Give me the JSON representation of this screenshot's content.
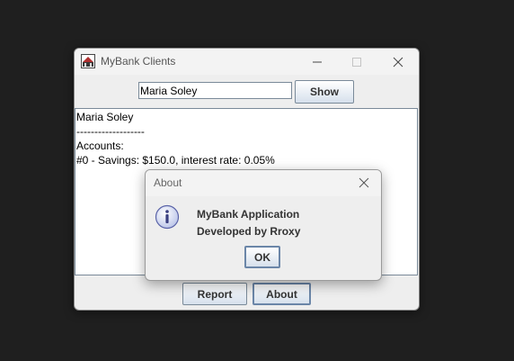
{
  "main_window": {
    "title": "MyBank Clients",
    "icon": "mybank-app-icon",
    "controls": [
      "minimize-icon",
      "maximize-icon",
      "close-icon"
    ],
    "search": {
      "value": "Maria Soley"
    },
    "show_label": "Show",
    "output_lines": [
      "Maria Soley",
      "-------------------",
      "Accounts:",
      "#0 - Savings: $150.0, interest rate: 0.05%"
    ],
    "report_label": "Report",
    "about_label": "About"
  },
  "about_dialog": {
    "title": "About",
    "icon": "info-icon",
    "line1": "MyBank Application",
    "line2": "Developed by Rroxy",
    "ok_label": "OK"
  }
}
